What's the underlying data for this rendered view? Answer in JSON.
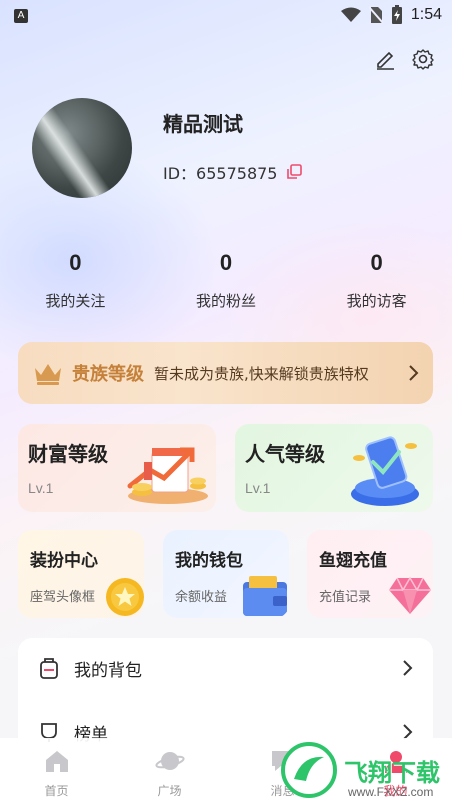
{
  "status_bar": {
    "time": "1:54",
    "app_indicator": "A"
  },
  "profile": {
    "username": "精品测试",
    "id_label": "ID：",
    "id_value": "65575875"
  },
  "stats": [
    {
      "value": "0",
      "label": "我的关注"
    },
    {
      "value": "0",
      "label": "我的粉丝"
    },
    {
      "value": "0",
      "label": "我的访客"
    }
  ],
  "noble": {
    "title": "贵族等级",
    "description": "暂未成为贵族,快来解锁贵族特权"
  },
  "levels": {
    "wealth": {
      "title": "财富等级",
      "level": "Lv.1"
    },
    "popularity": {
      "title": "人气等级",
      "level": "Lv.1"
    }
  },
  "features": {
    "dress": {
      "title": "装扮中心",
      "subtitle": "座驾头像框"
    },
    "wallet": {
      "title": "我的钱包",
      "subtitle": "余额收益"
    },
    "recharge": {
      "title": "鱼翅充值",
      "subtitle": "充值记录"
    }
  },
  "menu": [
    {
      "label": "我的背包",
      "icon": "backpack-icon"
    },
    {
      "label": "榜单",
      "icon": "ranking-icon"
    }
  ],
  "tabbar": [
    {
      "label": "首页",
      "icon": "home-icon"
    },
    {
      "label": "广场",
      "icon": "planet-icon"
    },
    {
      "label": "消息",
      "icon": "message-icon"
    },
    {
      "label": "我的",
      "icon": "profile-icon"
    }
  ],
  "watermark": {
    "text": "飞翔下载",
    "url": "www.FXXZ.com"
  },
  "colors": {
    "noble_gold": "#c5813a",
    "wealth_bg": "#fde8e4",
    "popularity_bg": "#e2f6e0",
    "active_tab": "#f04a6a"
  }
}
